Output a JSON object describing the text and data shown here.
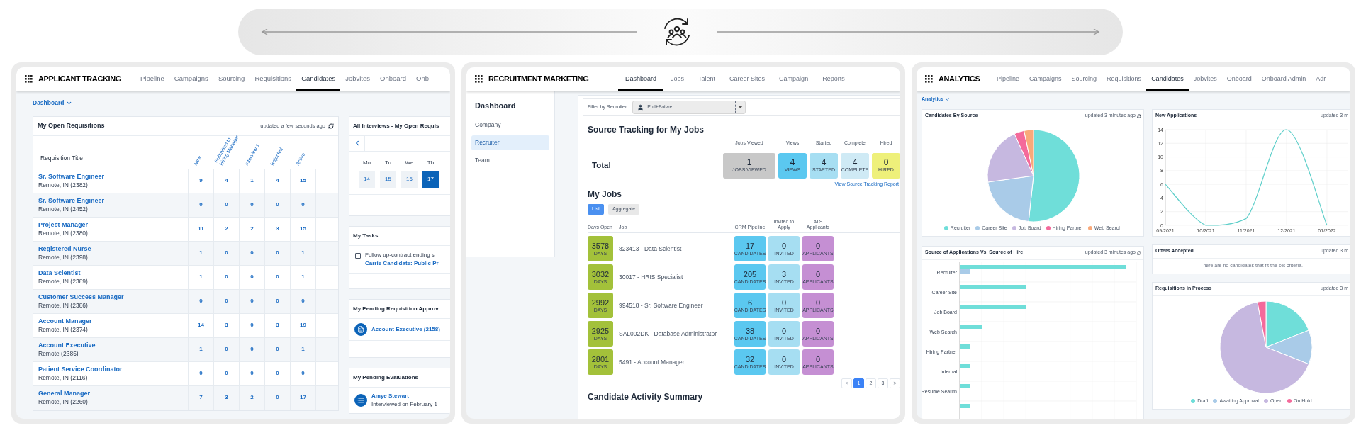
{
  "applicant_tracking": {
    "title": "APPLICANT TRACKING",
    "tabs": [
      {
        "label": "Pipeline",
        "selected": false
      },
      {
        "label": "Campaigns",
        "selected": false
      },
      {
        "label": "Sourcing",
        "selected": false
      },
      {
        "label": "Requisitions",
        "selected": false
      },
      {
        "label": "Candidates",
        "selected": true
      },
      {
        "label": "Jobvites",
        "selected": false
      },
      {
        "label": "Onboard",
        "selected": false
      },
      {
        "label": "Onb",
        "selected": false
      }
    ],
    "menu": "Dashboard",
    "requisitions": {
      "title": "My Open Requisitions",
      "updated": "updated a few seconds ago",
      "title_column": "Requisition Title",
      "columns": [
        "New",
        "Submitted to Hiring Manager",
        "Interview 1",
        "Rejected",
        "Active"
      ],
      "rows": [
        {
          "title": "Sr. Software Engineer",
          "location": "Remote, IN (2382)",
          "counts": [
            "9",
            "4",
            "1",
            "4",
            "15"
          ]
        },
        {
          "title": "Sr. Software Engineer",
          "location": "Remote, IN (2452)",
          "counts": [
            "0",
            "0",
            "0",
            "0",
            "0"
          ]
        },
        {
          "title": "Project Manager",
          "location": "Remote, IN (2380)",
          "counts": [
            "11",
            "2",
            "2",
            "3",
            "15"
          ]
        },
        {
          "title": "Registered Nurse",
          "location": "Remote, IN (2398)",
          "counts": [
            "1",
            "0",
            "0",
            "0",
            "1"
          ]
        },
        {
          "title": "Data Scientist",
          "location": "Remote, IN (2389)",
          "counts": [
            "1",
            "0",
            "0",
            "0",
            "1"
          ]
        },
        {
          "title": "Customer Success Manager",
          "location": "Remote, IN (2386)",
          "counts": [
            "0",
            "0",
            "0",
            "0",
            "0"
          ]
        },
        {
          "title": "Account Manager",
          "location": "Remote, IN (2374)",
          "counts": [
            "14",
            "3",
            "0",
            "3",
            "19"
          ]
        },
        {
          "title": "Account Executive",
          "location": "Remote (2385)",
          "counts": [
            "1",
            "0",
            "0",
            "0",
            "1"
          ]
        },
        {
          "title": "Patient Service Coordinator",
          "location": "Remote, IN (2116)",
          "counts": [
            "0",
            "0",
            "0",
            "0",
            "0"
          ]
        },
        {
          "title": "General Manager",
          "location": "Remote, IN (2260)",
          "counts": [
            "7",
            "3",
            "2",
            "0",
            "17"
          ]
        }
      ]
    },
    "interviews": {
      "title": "All Interviews - My Open Requis",
      "days": [
        {
          "label": "Mo",
          "date": "14",
          "selected": false
        },
        {
          "label": "Tu",
          "date": "15",
          "selected": false
        },
        {
          "label": "We",
          "date": "16",
          "selected": false
        },
        {
          "label": "Th",
          "date": "17",
          "selected": true
        }
      ]
    },
    "tasks": {
      "title": "My Tasks",
      "items": [
        {
          "text": "Follow up-contract ending s",
          "link": "Carrie Candidate: Public Pr",
          "checked": false
        }
      ]
    },
    "approvals": {
      "title": "My Pending Requisition Approv",
      "items": [
        "Account Executive (2158)"
      ]
    },
    "evaluations": {
      "title": "My Pending Evaluations",
      "items": [
        {
          "name": "Amye Stewart",
          "detail": "Interviewed on February 1"
        }
      ]
    }
  },
  "recruitment_marketing": {
    "title": "RECRUITMENT MARKETING",
    "tabs": [
      {
        "label": "Dashboard",
        "selected": true
      },
      {
        "label": "Jobs",
        "selected": false
      },
      {
        "label": "Talent",
        "selected": false
      },
      {
        "label": "Career Sites",
        "selected": false
      },
      {
        "label": "Campaign",
        "selected": false
      },
      {
        "label": "Reports",
        "selected": false
      }
    ],
    "sidebar": {
      "title": "Dashboard",
      "items": [
        {
          "label": "Company",
          "selected": false
        },
        {
          "label": "Recruiter",
          "selected": true
        },
        {
          "label": "Team",
          "selected": false
        }
      ]
    },
    "filter": {
      "label": "Filter by Recruiter:",
      "value": "Phil+Faivre"
    },
    "tracking": {
      "title": "Source Tracking for My Jobs",
      "row_label": "Total",
      "tiles": [
        {
          "header": "Jobs Viewed",
          "value": "1",
          "label": "JOBS VIEWED",
          "color": "#c8c8c8"
        },
        {
          "header": "Views",
          "value": "4",
          "label": "VIEWS",
          "color": "#5bc8f0"
        },
        {
          "header": "Started",
          "value": "4",
          "label": "STARTED",
          "color": "#a6def2"
        },
        {
          "header": "Complete",
          "value": "4",
          "label": "COMPLETE",
          "color": "#cfeaf5"
        },
        {
          "header": "Hired",
          "value": "0",
          "label": "HIRED",
          "color": "#eef07a"
        }
      ],
      "link": "View Source Tracking Report"
    },
    "jobs": {
      "title": "My Jobs",
      "views": [
        {
          "label": "List",
          "selected": true
        },
        {
          "label": "Aggregate",
          "selected": false
        }
      ],
      "columns": [
        "Days Open",
        "Job",
        "CRM Pipeline",
        "Invited to Apply",
        "ATS Applicants"
      ],
      "rows": [
        {
          "days": "3578",
          "days_label": "DAYS",
          "job": "823413 - Data Scientist",
          "crm": "17",
          "crm_label": "CANDIDATES",
          "invited": "0",
          "invited_label": "INVITED",
          "ats": "0",
          "ats_label": "APPLICANTS"
        },
        {
          "days": "3032",
          "days_label": "DAYS",
          "job": "30017 - HRIS Specialist",
          "crm": "205",
          "crm_label": "CANDIDATES",
          "invited": "3",
          "invited_label": "INVITED",
          "ats": "0",
          "ats_label": "APPLICANTS"
        },
        {
          "days": "2992",
          "days_label": "DAYS",
          "job": "994518 - Sr. Software Engineer",
          "crm": "6",
          "crm_label": "CANDIDATES",
          "invited": "0",
          "invited_label": "INVITED",
          "ats": "0",
          "ats_label": "APPLICANTS"
        },
        {
          "days": "2925",
          "days_label": "DAYS",
          "job": "SAL002DK - Database Administrator",
          "crm": "38",
          "crm_label": "CANDIDATES",
          "invited": "0",
          "invited_label": "INVITED",
          "ats": "0",
          "ats_label": "APPLICANTS"
        },
        {
          "days": "2801",
          "days_label": "DAYS",
          "job": "5491 - Account Manager",
          "crm": "32",
          "crm_label": "CANDIDATES",
          "invited": "0",
          "invited_label": "INVITED",
          "ats": "0",
          "ats_label": "APPLICANTS"
        }
      ],
      "pages": [
        {
          "label": "<",
          "selected": false,
          "disabled": true
        },
        {
          "label": "1",
          "selected": true,
          "disabled": false
        },
        {
          "label": "2",
          "selected": false,
          "disabled": false
        },
        {
          "label": "3",
          "selected": false,
          "disabled": false
        },
        {
          "label": ">",
          "selected": false,
          "disabled": false
        }
      ]
    },
    "activity": {
      "title": "Candidate Activity Summary"
    }
  },
  "analytics": {
    "title": "ANALYTICS",
    "tabs": [
      {
        "label": "Pipeline",
        "selected": false
      },
      {
        "label": "Campaigns",
        "selected": false
      },
      {
        "label": "Sourcing",
        "selected": false
      },
      {
        "label": "Requisitions",
        "selected": false
      },
      {
        "label": "Candidates",
        "selected": true
      },
      {
        "label": "Jobvites",
        "selected": false
      },
      {
        "label": "Onboard",
        "selected": false
      },
      {
        "label": "Onboard Admin",
        "selected": false
      },
      {
        "label": "Adr",
        "selected": false
      }
    ],
    "menu": "Analytics",
    "candidates_by_source": {
      "title": "Candidates By Source",
      "updated": "updated 3 minutes ago",
      "legend": [
        {
          "label": "Recruiter",
          "color": "#6fded9"
        },
        {
          "label": "Career Site",
          "color": "#a9cbe8"
        },
        {
          "label": "Job Board",
          "color": "#c6b8e0"
        },
        {
          "label": "Hiring Partner",
          "color": "#f46a9b"
        },
        {
          "label": "Web Search",
          "color": "#f9a97a"
        }
      ]
    },
    "new_applications": {
      "title": "New Applications",
      "updated": "updated 3 m",
      "chart_data": {
        "type": "line",
        "categories": [
          "09/2021",
          "10/2021",
          "11/2021",
          "12/2021",
          "01/2022"
        ],
        "series": [
          {
            "color": "#5fcfca",
            "values": [
              6,
              0,
              1,
              14,
              0
            ]
          }
        ],
        "yticks": [
          0,
          2,
          4,
          6,
          8,
          10,
          12,
          14
        ],
        "ylim": [
          0,
          14
        ],
        "grid": true
      }
    },
    "source_vs_hire": {
      "title": "Source of Applications Vs. Source of Hire",
      "updated": "updated 3 minutes ago",
      "categories": [
        "Recruiter",
        "Career Site",
        "Job Board",
        "Web Search",
        "Hiring Partner",
        "Internal",
        "Resume Search"
      ]
    },
    "offers_accepted": {
      "title": "Offers Accepted",
      "updated": "updated 3 m",
      "message": "There are no candidates that fit the set criteria."
    },
    "requisitions_in_process": {
      "title": "Requisitions in Process",
      "updated": "updated 3 m",
      "legend": [
        {
          "label": "Draft",
          "color": "#6fded9"
        },
        {
          "label": "Awaiting Approval",
          "color": "#a9cbe8"
        },
        {
          "label": "Open",
          "color": "#c6b8e0"
        },
        {
          "label": "On Hold",
          "color": "#f46a9b"
        }
      ]
    }
  }
}
